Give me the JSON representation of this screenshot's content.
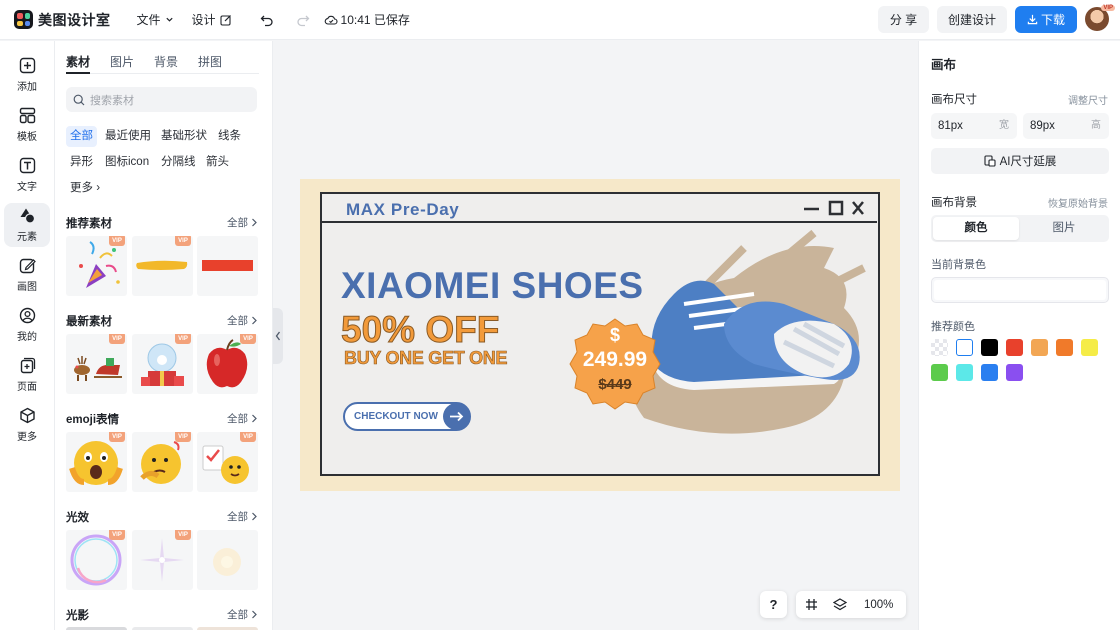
{
  "app": {
    "name": "美图设计室"
  },
  "topbar": {
    "file_label": "文件",
    "design_label": "设计",
    "save_status": "10:41 已保存",
    "share_label": "分 享",
    "create_label": "创建设计",
    "download_label": "下载"
  },
  "avatar": {
    "badge": "VIP"
  },
  "sidebar": {
    "items": [
      {
        "label": "添加",
        "icon": "plus-square-icon"
      },
      {
        "label": "模板",
        "icon": "layout-icon"
      },
      {
        "label": "文字",
        "icon": "text-icon"
      },
      {
        "label": "元素",
        "icon": "shapes-icon"
      },
      {
        "label": "画图",
        "icon": "pen-icon"
      },
      {
        "label": "我的",
        "icon": "user-icon"
      },
      {
        "label": "页面",
        "icon": "page-icon"
      },
      {
        "label": "更多",
        "icon": "cube-icon"
      }
    ]
  },
  "panel": {
    "tabs": [
      "素材",
      "图片",
      "背景",
      "拼图"
    ],
    "search_placeholder": "搜索素材",
    "chips": [
      "全部",
      "最近使用",
      "基础形状",
      "线条",
      "异形",
      "图标icon",
      "分隔线",
      "箭头",
      "更多"
    ],
    "vip": "VIP",
    "see_all": "全部",
    "sections": [
      {
        "title": "推荐素材"
      },
      {
        "title": "最新素材"
      },
      {
        "title": "emoji表情"
      },
      {
        "title": "光效"
      },
      {
        "title": "光影"
      }
    ]
  },
  "banner": {
    "window_title": "MAX Pre-Day",
    "headline": "XIAOMEI SHOES",
    "offer": "50% OFF",
    "promo": "BUY ONE GET ONE",
    "cta": "CHECKOUT NOW",
    "currency": "$",
    "price": "249.99",
    "old_price": "$449"
  },
  "canvas_tools": {
    "help": "?",
    "zoom": "100%"
  },
  "right_panel": {
    "title": "画布",
    "size_label": "画布尺寸",
    "resize_link": "调整尺寸",
    "width_value": "81px",
    "width_unit": "宽",
    "height_value": "89px",
    "height_unit": "高",
    "ai_extend": "AI尺寸延展",
    "bg_label": "画布背景",
    "restore_link": "恢复原始背景",
    "color_tab": "颜色",
    "image_tab": "图片",
    "current_bg_label": "当前背景色",
    "recommended_label": "推荐颜色",
    "swatches": [
      "transparent",
      "#ffffff",
      "#000000",
      "#e8412c",
      "#f2a654",
      "#f07a2a",
      "#f5ec47",
      "#5ccb4c",
      "#5ce8e8",
      "#2a7ff0",
      "#8a4ff0"
    ]
  },
  "colors": {
    "accent": "#1f7ef0",
    "banner_blue": "#4a6fae",
    "banner_orange": "#f29a3a",
    "banner_bg": "#f6e8c9"
  }
}
